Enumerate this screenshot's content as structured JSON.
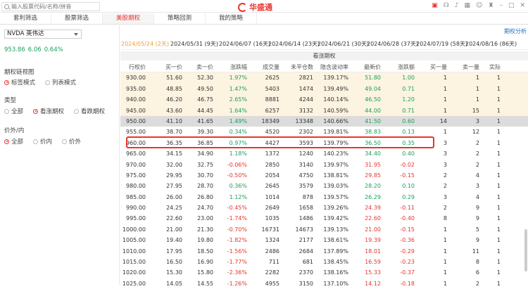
{
  "topbar": {
    "search_placeholder": "输入股票代码/名称/拼音",
    "brand": "华盛通",
    "icons": [
      "chat-icon",
      "headset-icon",
      "bell-icon",
      "gift-icon",
      "user-icon",
      "shirt-icon",
      "minimize-icon",
      "maximize-icon",
      "close-icon"
    ]
  },
  "tabs": [
    "套利筛选",
    "股票筛选",
    "美股期权",
    "策略回测",
    "我的策略"
  ],
  "active_tab": 2,
  "left": {
    "symbol": "NVDA 英伟达",
    "price": "953.86",
    "change": "6.06",
    "change_pct": "0.64%",
    "view_title": "期权链视图",
    "view_options": [
      "标签模式",
      "列表模式"
    ],
    "view_selected": 0,
    "type_title": "类型",
    "type_options": [
      "全部",
      "看涨期权",
      "看跌期权"
    ],
    "type_selected": 1,
    "moneyness_title": "价外/内",
    "moneyness_options": [
      "全部",
      "价内",
      "价外"
    ],
    "moneyness_selected": 0
  },
  "main": {
    "analysis_link": "期权分析",
    "dates": [
      "2024/05/24 (2天)",
      "2024/05/31 (9天)",
      "2024/06/07 (16天)",
      "2024/06/14 (23天)",
      "2024/06/21 (30天)",
      "2024/06/28 (37天)",
      "2024/07/19 (58天)",
      "2024/08/16 (86天)"
    ],
    "active_date": 0,
    "section_title": "看涨期权",
    "columns": [
      "行权价",
      "买一价",
      "卖一价",
      "涨跌幅",
      "成交量",
      "未平仓数",
      "隐含波动率",
      "最新价",
      "涨跌额",
      "买一量",
      "卖一量",
      "实际"
    ],
    "rows": [
      [
        "930.00",
        "51.60",
        "52.30",
        "1.97%",
        "2625",
        "2821",
        "139.17%",
        "51.80",
        "1.00",
        "1",
        "1",
        "1"
      ],
      [
        "935.00",
        "48.85",
        "49.50",
        "1.47%",
        "5403",
        "1474",
        "139.49%",
        "49.04",
        "0.71",
        "1",
        "1",
        "1"
      ],
      [
        "940.00",
        "46.20",
        "46.75",
        "2.65%",
        "8881",
        "4244",
        "140.14%",
        "46.50",
        "1.20",
        "1",
        "1",
        "1"
      ],
      [
        "945.00",
        "43.60",
        "44.45",
        "1.64%",
        "6257",
        "3132",
        "140.59%",
        "44.00",
        "0.71",
        "1",
        "15",
        "1"
      ],
      [
        "950.00",
        "41.10",
        "41.65",
        "1.49%",
        "18349",
        "13348",
        "140.66%",
        "41.50",
        "0.60",
        "14",
        "3",
        "1"
      ],
      [
        "955.00",
        "38.70",
        "39.30",
        "0.34%",
        "4520",
        "2302",
        "139.81%",
        "38.83",
        "0.13",
        "1",
        "12",
        "1"
      ],
      [
        "960.00",
        "36.35",
        "36.85",
        "0.97%",
        "4427",
        "3593",
        "139.79%",
        "36.50",
        "0.35",
        "3",
        "2",
        "1"
      ],
      [
        "965.00",
        "34.15",
        "34.90",
        "1.18%",
        "1372",
        "1240",
        "140.23%",
        "34.40",
        "0.40",
        "3",
        "2",
        "1"
      ],
      [
        "970.00",
        "32.00",
        "32.75",
        "-0.06%",
        "2850",
        "3140",
        "139.97%",
        "31.95",
        "-0.02",
        "3",
        "2",
        "1"
      ],
      [
        "975.00",
        "29.95",
        "30.70",
        "-0.50%",
        "2054",
        "4750",
        "138.81%",
        "29.85",
        "-0.15",
        "2",
        "4",
        "1"
      ],
      [
        "980.00",
        "27.95",
        "28.70",
        "0.36%",
        "2645",
        "3579",
        "139.03%",
        "28.20",
        "0.10",
        "2",
        "3",
        "1"
      ],
      [
        "985.00",
        "26.00",
        "26.80",
        "1.12%",
        "1014",
        "878",
        "139.57%",
        "26.29",
        "0.29",
        "3",
        "4",
        "1"
      ],
      [
        "990.00",
        "24.25",
        "24.70",
        "-0.45%",
        "2649",
        "1658",
        "139.26%",
        "24.39",
        "-0.11",
        "2",
        "9",
        "1"
      ],
      [
        "995.00",
        "22.60",
        "23.00",
        "-1.74%",
        "1035",
        "1486",
        "139.42%",
        "22.60",
        "-0.40",
        "8",
        "9",
        "1"
      ],
      [
        "1000.00",
        "21.00",
        "21.30",
        "-0.70%",
        "16731",
        "14673",
        "139.13%",
        "21.00",
        "-0.15",
        "1",
        "5",
        "1"
      ],
      [
        "1005.00",
        "19.40",
        "19.80",
        "-1.82%",
        "1324",
        "2177",
        "138.61%",
        "19.39",
        "-0.36",
        "1",
        "9",
        "1"
      ],
      [
        "1010.00",
        "17.95",
        "18.50",
        "-1.56%",
        "2486",
        "2684",
        "137.89%",
        "18.01",
        "-0.29",
        "1",
        "11",
        "1"
      ],
      [
        "1015.00",
        "16.50",
        "16.90",
        "-1.77%",
        "711",
        "681",
        "138.45%",
        "16.59",
        "-0.23",
        "1",
        "8",
        "1"
      ],
      [
        "1020.00",
        "15.30",
        "15.80",
        "-2.36%",
        "2282",
        "2370",
        "138.16%",
        "15.33",
        "-0.37",
        "1",
        "6",
        "1"
      ],
      [
        "1025.00",
        "14.05",
        "14.55",
        "-1.26%",
        "4955",
        "3150",
        "137.10%",
        "14.12",
        "-0.18",
        "1",
        "2",
        "1"
      ]
    ],
    "atm_row_index": 4,
    "highlighted_row_index": 6,
    "colors": {
      "up": "#19a15f",
      "down": "#e8352e",
      "accent": "#e8352e",
      "itm_bg": "#fcf3e0"
    }
  }
}
